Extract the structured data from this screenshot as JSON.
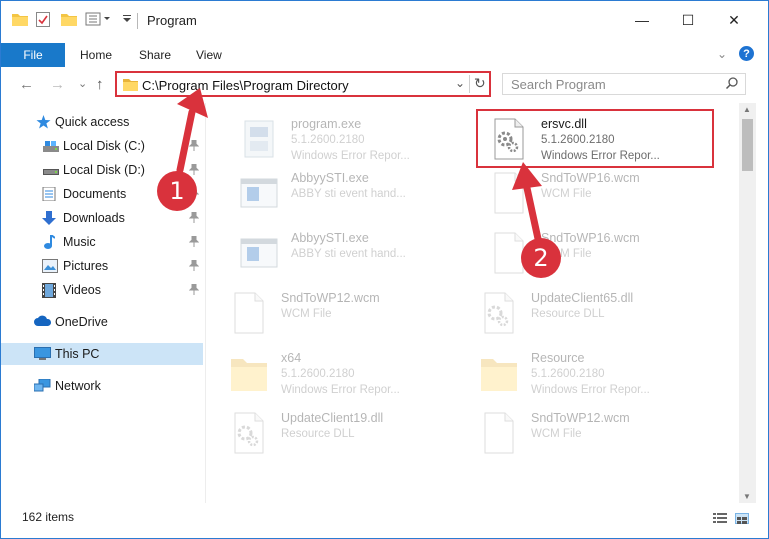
{
  "window": {
    "title": "Program",
    "minimize_glyph": "—",
    "maximize_glyph": "☐",
    "close_glyph": "✕"
  },
  "ribbon": {
    "tabs": [
      "File",
      "Home",
      "Share",
      "View"
    ],
    "expand_glyph": "⌄",
    "help_glyph": "?"
  },
  "nav": {
    "back_glyph": "←",
    "forward_glyph": "→",
    "recent_glyph": "⌄",
    "up_glyph": "↑",
    "address": "C:\\Program Files\\Program Directory",
    "address_dropdown_glyph": "⌄",
    "refresh_glyph": "↻",
    "search_placeholder": "Search Program"
  },
  "sidebar": {
    "items": [
      {
        "label": "Quick access",
        "icon": "star-icon",
        "pinned": false
      },
      {
        "label": "Local Disk (C:)",
        "icon": "drive-icon",
        "pinned": true
      },
      {
        "label": "Local Disk (D:)",
        "icon": "drive-icon",
        "pinned": true
      },
      {
        "label": "Documents",
        "icon": "documents-icon",
        "pinned": true
      },
      {
        "label": "Downloads",
        "icon": "download-icon",
        "pinned": true
      },
      {
        "label": "Music",
        "icon": "music-icon",
        "pinned": true
      },
      {
        "label": "Pictures",
        "icon": "pictures-icon",
        "pinned": true
      },
      {
        "label": "Videos",
        "icon": "videos-icon",
        "pinned": true
      },
      {
        "label": "OneDrive",
        "icon": "cloud-icon",
        "pinned": false
      },
      {
        "label": "This PC",
        "icon": "computer-icon",
        "pinned": false,
        "selected": true
      },
      {
        "label": "Network",
        "icon": "network-icon",
        "pinned": false
      }
    ],
    "pin_glyph": "📌"
  },
  "files": [
    {
      "name": "program.exe",
      "line1": "5.1.2600.2180",
      "line2": "Windows Error Repor...",
      "icon": "exe-icon",
      "highlighted": false
    },
    {
      "name": "ersvc.dll",
      "line1": "5.1.2600.2180",
      "line2": "Windows Error Repor...",
      "icon": "dll-gear-icon",
      "highlighted": true
    },
    {
      "name": "AbbyySTI.exe",
      "line1": "ABBY sti event hand...",
      "line2": "",
      "icon": "app-window-icon",
      "highlighted": false
    },
    {
      "name": "SndToWP16.wcm",
      "line1": "WCM File",
      "line2": "",
      "icon": "blank-file-icon",
      "highlighted": false
    },
    {
      "name": "AbbyySTI.exe",
      "line1": "ABBY sti event hand...",
      "line2": "",
      "icon": "app-window-icon",
      "highlighted": false
    },
    {
      "name": "SndToWP16.wcm",
      "line1": "WCM File",
      "line2": "",
      "icon": "blank-file-icon",
      "highlighted": false
    },
    {
      "name": "SndToWP12.wcm",
      "line1": "WCM File",
      "line2": "",
      "icon": "blank-file-icon",
      "highlighted": false
    },
    {
      "name": "UpdateClient65.dll",
      "line1": "Resource DLL",
      "line2": "",
      "icon": "dll-gear-icon",
      "highlighted": false
    },
    {
      "name": "x64",
      "line1": "5.1.2600.2180",
      "line2": "Windows Error Repor...",
      "icon": "folder-icon",
      "highlighted": false
    },
    {
      "name": "Resource",
      "line1": "5.1.2600.2180",
      "line2": "Windows Error Repor...",
      "icon": "folder-icon",
      "highlighted": false
    },
    {
      "name": "UpdateClient19.dll",
      "line1": "Resource DLL",
      "line2": "",
      "icon": "dll-gear-icon",
      "highlighted": false
    },
    {
      "name": "SndToWP12.wcm",
      "line1": "WCM File",
      "line2": "",
      "icon": "blank-file-icon",
      "highlighted": false
    }
  ],
  "status": {
    "item_count": "162 items"
  },
  "callouts": [
    {
      "number": "1"
    },
    {
      "number": "2"
    }
  ],
  "colors": {
    "accent": "#1979ca",
    "callout_red": "#d9323c",
    "selection": "#cce4f7"
  }
}
